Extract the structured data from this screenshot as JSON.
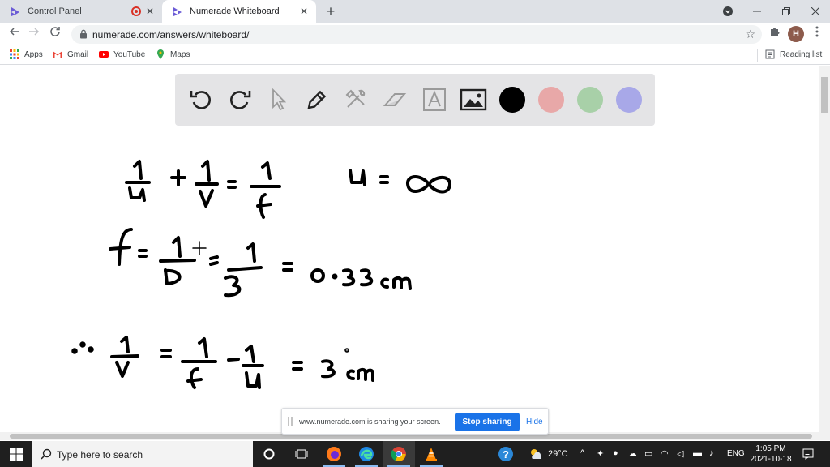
{
  "browser": {
    "tabs": [
      {
        "title": "Control Panel",
        "active": false,
        "recording": true
      },
      {
        "title": "Numerade Whiteboard",
        "active": true
      }
    ],
    "new_tab_symbol": "+",
    "close_symbol": "✕",
    "url": "numerade.com/answers/whiteboard/",
    "profile_initial": "H",
    "window_controls": [
      "chevron-down",
      "minimize",
      "restore",
      "close"
    ]
  },
  "bookmarks": [
    {
      "label": "Apps",
      "icon": "apps-grid-icon"
    },
    {
      "label": "Gmail",
      "icon": "gmail-icon"
    },
    {
      "label": "YouTube",
      "icon": "youtube-icon"
    },
    {
      "label": "Maps",
      "icon": "maps-icon"
    }
  ],
  "reading_list": "Reading list",
  "whiteboard": {
    "tools": [
      "undo",
      "redo",
      "select",
      "pen",
      "tools",
      "eraser",
      "text",
      "image"
    ],
    "colors": [
      "#000000",
      "#e8a8a8",
      "#a8d0a8",
      "#a8a8e8"
    ],
    "equations": [
      {
        "line": 1,
        "content": "1/u + 1/v = 1/f      u = ∞"
      },
      {
        "line": 2,
        "content": "f = 1/D = 1/3 = 0.33 cm"
      },
      {
        "line": 3,
        "content": "∴ 1/v = 1/f − 1/u = 3 cm"
      }
    ]
  },
  "share_banner": {
    "message": "www.numerade.com is sharing your screen.",
    "stop_label": "Stop sharing",
    "hide_label": "Hide"
  },
  "taskbar": {
    "search_placeholder": "Type here to search",
    "weather": "29°C",
    "language": "ENG",
    "time": "1:05 PM",
    "date": "2021-10-18"
  },
  "colors": {
    "accent": "#1a73e8",
    "tab_strip": "#dee1e6",
    "toolbar_panel": "#e4e4e6",
    "taskbar": "#1f1f1f"
  }
}
